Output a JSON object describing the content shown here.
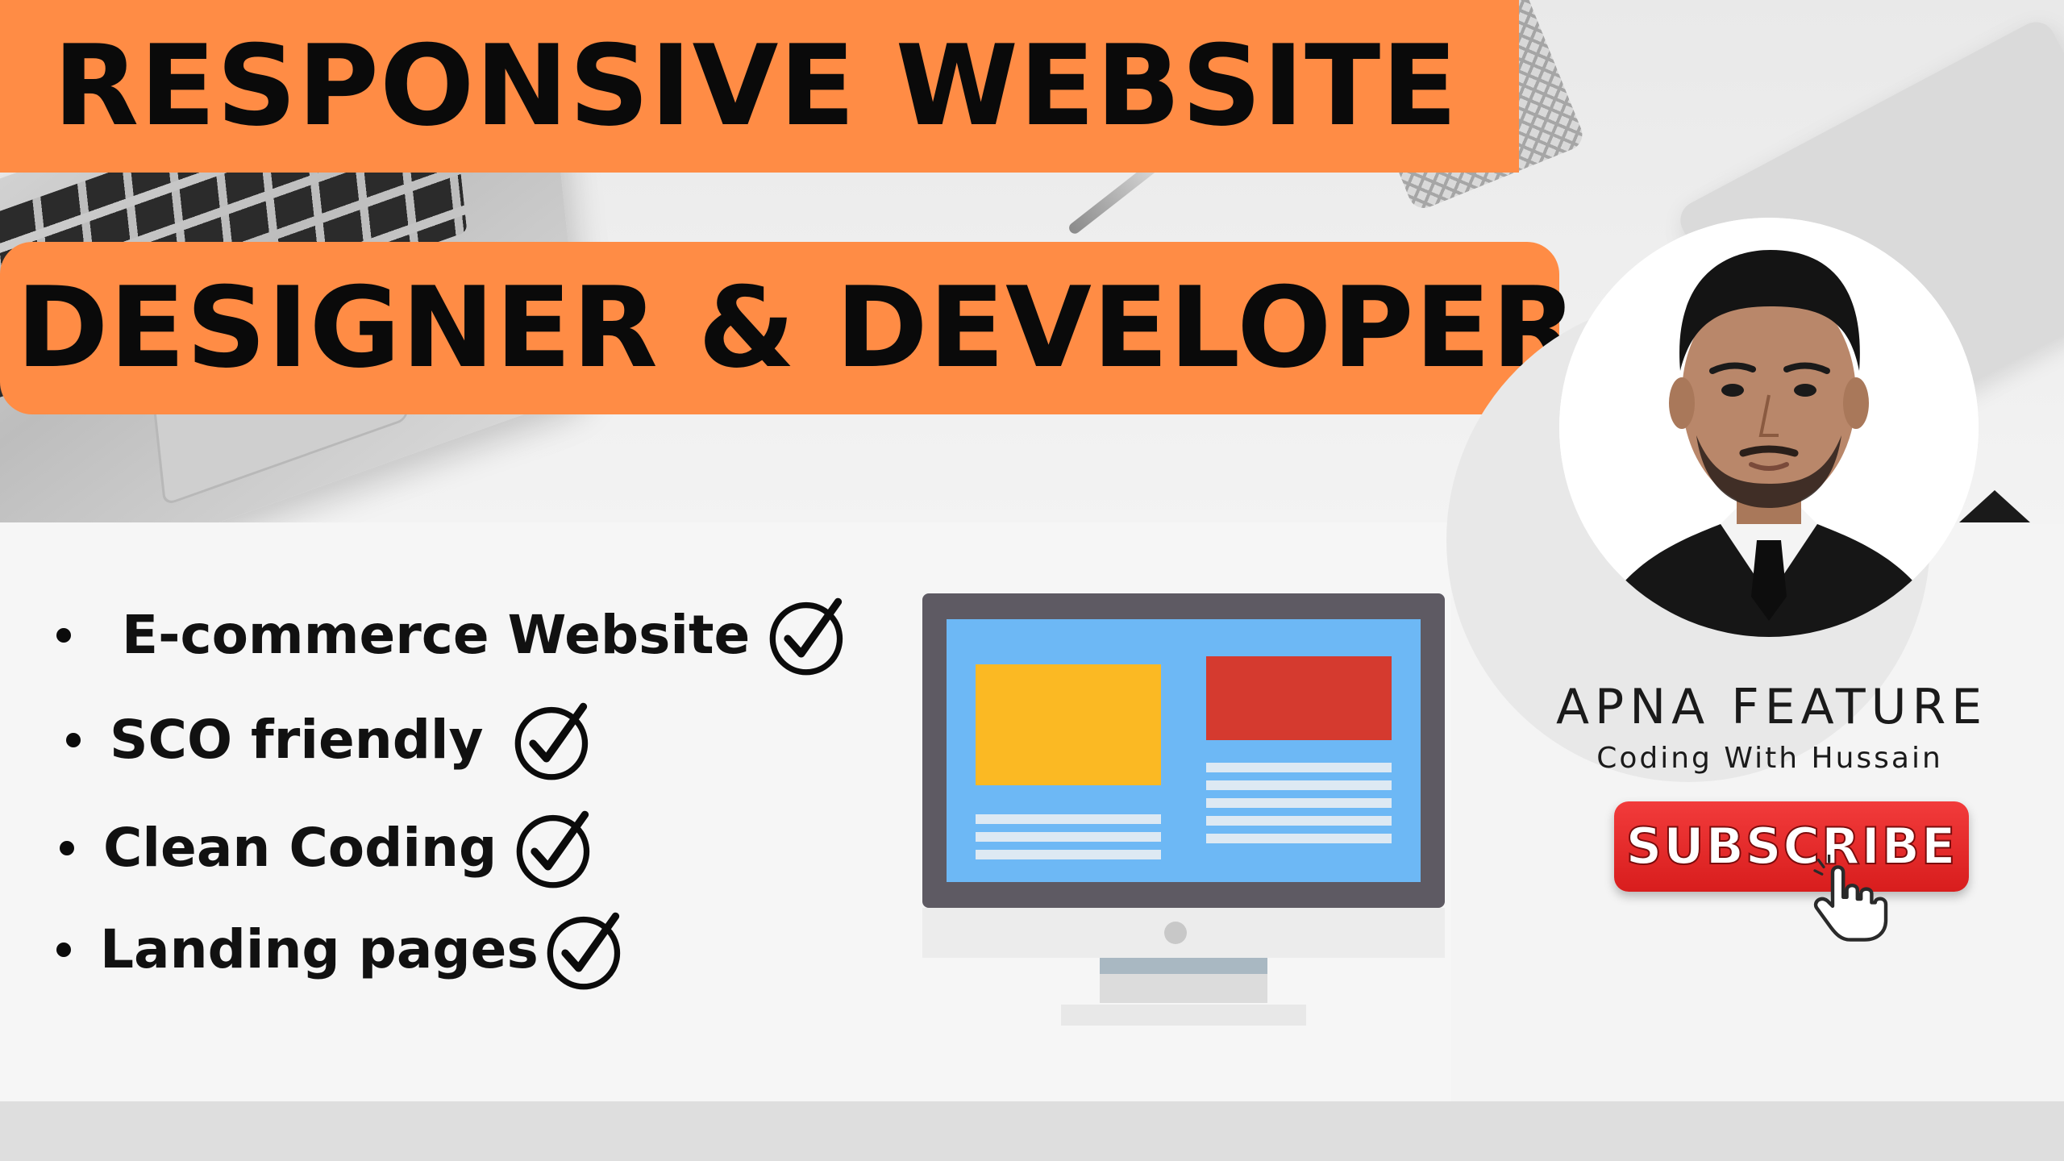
{
  "headline": {
    "line1": "RESPONSIVE WEBSITE",
    "line2": "DESIGNER & DEVELOPER"
  },
  "features": [
    {
      "label": " E-commerce Website",
      "icon": "check-circle-icon"
    },
    {
      "label": "SCO friendly",
      "icon": "check-circle-icon"
    },
    {
      "label": "Clean Coding",
      "icon": "check-circle-icon"
    },
    {
      "label": "Landing pages",
      "icon": "check-circle-icon"
    }
  ],
  "channel": {
    "name": "APNA FEATURE",
    "tagline": "Coding With Hussain"
  },
  "subscribe": {
    "label": "SUBSCRIBE"
  },
  "colors": {
    "banner": "#ff8c45",
    "subscribe": "#e02828",
    "monitor_screen": "#6db8f5",
    "monitor_yellow": "#fbb923",
    "monitor_red": "#d53a2f"
  }
}
